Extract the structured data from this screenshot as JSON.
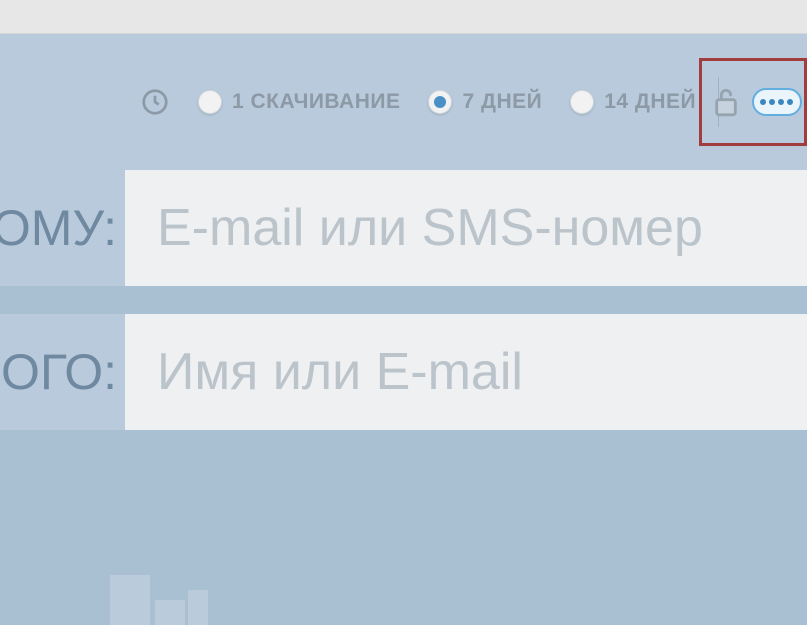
{
  "options": {
    "radios": [
      {
        "label": "1 СКАЧИВАНИЕ",
        "checked": false
      },
      {
        "label": "7 ДНЕЙ",
        "checked": true
      },
      {
        "label": "14 ДНЕЙ",
        "checked": false
      }
    ],
    "password_value": "••••"
  },
  "fields": {
    "to": {
      "label": "ОМУ:",
      "placeholder": "E-mail или SMS-номер"
    },
    "from": {
      "label": "ОГО:",
      "placeholder": "Имя или E-mail"
    }
  },
  "colors": {
    "highlight_box": "#a23d3d",
    "accent": "#4a90c7"
  }
}
